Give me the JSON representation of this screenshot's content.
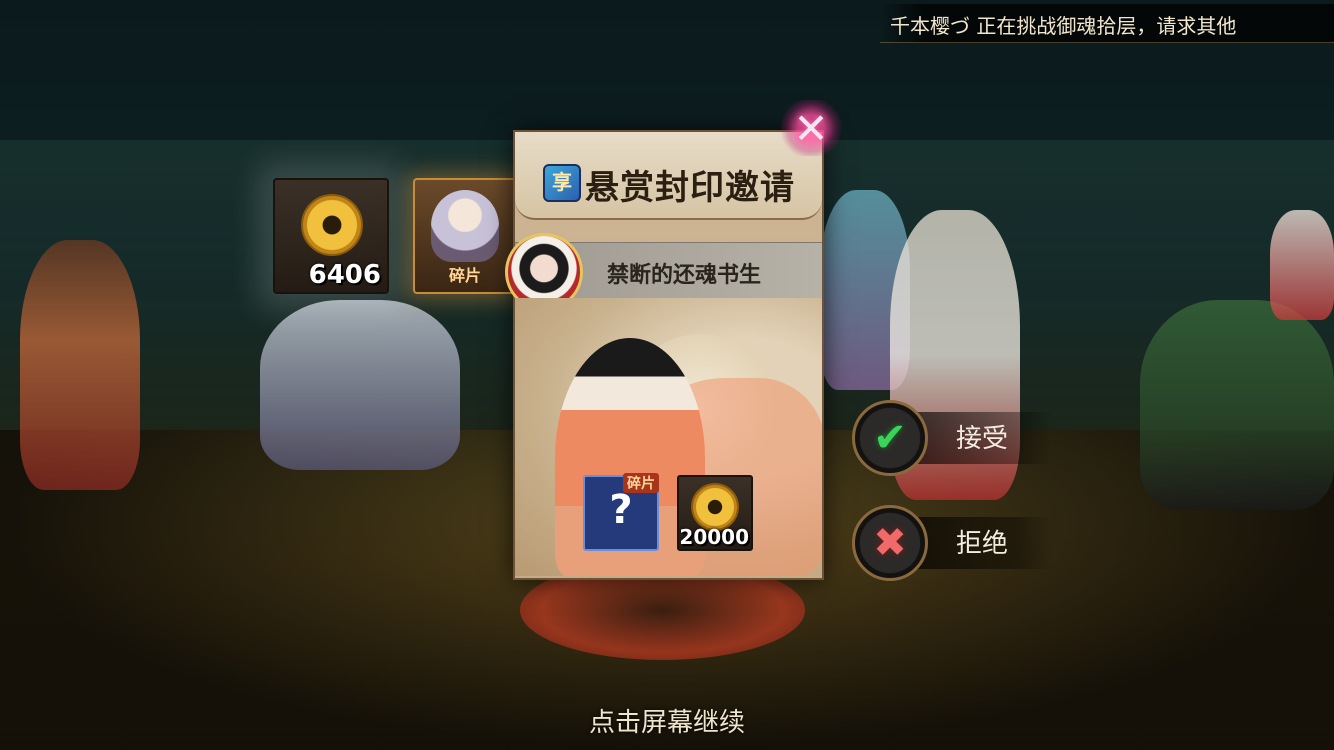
{
  "broadcast": {
    "message": "千本樱づ 正在挑战御魂拾层，请求其他"
  },
  "rewards": {
    "coin": {
      "icon": "gold-coin-icon",
      "value": "6406"
    },
    "shard": {
      "icon": "shikigami-portrait",
      "label": "碎片"
    }
  },
  "modal": {
    "badge": "享",
    "title": "悬赏封印邀请",
    "target_name": "禁断的还魂书生",
    "reward_slots": [
      {
        "icon": "mystery-shikigami",
        "symbol": "?",
        "tag": "碎片"
      },
      {
        "icon": "gold-coin-icon",
        "value": "20000"
      }
    ]
  },
  "actions": {
    "accept": {
      "icon": "checkmark-icon",
      "symbol": "✔",
      "label": "接受",
      "color": "#3bd45a"
    },
    "reject": {
      "icon": "cross-icon",
      "symbol": "✖",
      "label": "拒绝",
      "color": "#f06a6a"
    }
  },
  "close": {
    "icon": "close-icon",
    "symbol": "✕"
  },
  "footer": {
    "continue_prompt": "点击屏幕继续"
  }
}
